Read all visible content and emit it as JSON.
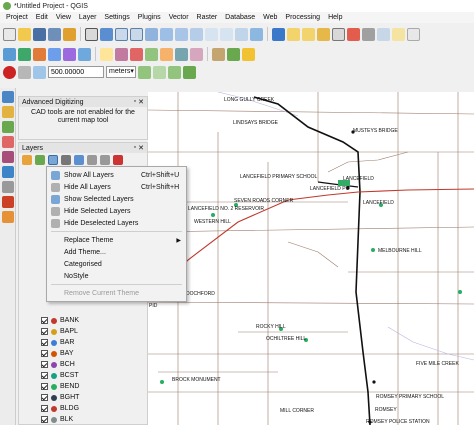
{
  "window": {
    "title": "*Untitled Project - QGIS"
  },
  "menubar": [
    "Project",
    "Edit",
    "View",
    "Layer",
    "Settings",
    "Plugins",
    "Vector",
    "Raster",
    "Database",
    "Web",
    "Processing",
    "Help"
  ],
  "scale": {
    "value": "500.00000",
    "units": "meters"
  },
  "advanced_digitizing": {
    "title": "Advanced Digitizing",
    "message": "CAD tools are not enabled for the current map tool"
  },
  "layers_panel": {
    "title": "Layers",
    "layers": [
      {
        "name": "BANK",
        "color": "#c0392b"
      },
      {
        "name": "BAPL",
        "color": "#d4a017"
      },
      {
        "name": "BAR",
        "color": "#3b7dd8"
      },
      {
        "name": "BAY",
        "color": "#d35400"
      },
      {
        "name": "BCH",
        "color": "#8e44ad"
      },
      {
        "name": "BCST",
        "color": "#16a085"
      },
      {
        "name": "BEND",
        "color": "#27ae60"
      },
      {
        "name": "BGHT",
        "color": "#2c3e50"
      },
      {
        "name": "BLDG",
        "color": "#c0392b"
      },
      {
        "name": "BLK",
        "color": "#7f8c8d"
      }
    ]
  },
  "context_menu": {
    "items": [
      {
        "label": "Show All Layers",
        "shortcut": "Ctrl+Shift+U",
        "icon": "eye-icon"
      },
      {
        "label": "Hide All Layers",
        "shortcut": "Ctrl+Shift+H",
        "icon": "eye-closed-icon"
      },
      {
        "label": "Show Selected Layers",
        "shortcut": "",
        "icon": "eye-icon"
      },
      {
        "label": "Hide Selected Layers",
        "shortcut": "",
        "icon": "eye-closed-icon"
      },
      {
        "label": "Hide Deselected Layers",
        "shortcut": "",
        "icon": "eye-closed-icon"
      }
    ],
    "theme_items": [
      {
        "label": "Replace Theme",
        "submenu": true
      },
      {
        "label": "Add Theme...",
        "submenu": false
      },
      {
        "label": "Categorised",
        "submenu": false
      },
      {
        "label": "NoStyle",
        "submenu": false
      }
    ],
    "remove_theme": "Remove Current Theme"
  },
  "map": {
    "labels": {
      "long_gully_creek": "LONG GULLY CREEK",
      "lindsays_bridge": "LINDSAYS BRIDGE",
      "musteys_bridge": "MUSTEYS BRIDGE",
      "lancefield_ps": "LANCEFIELD PRIMARY SCHOOL",
      "lancefield_town": "LANCEFIELD",
      "lancefield_town2": "LANCEFIELD",
      "lancefield_pp": "LANCEFIELD PO",
      "seven_roads": "SEVEN ROADS CORNER",
      "western_hill": "WESTERN HILL",
      "lancefield_no2": "LANCEFIELD NO. 2 RESERVOIR",
      "melbourne_hill": "MELBOURNE HILL",
      "dochford": "DOCHFORD",
      "rocky_hill": "ROCKY HILL",
      "ochiltree_hill": "OCHILTREE HILL",
      "five_mile_creek": "FIVE MILE CREEK",
      "brock_monument": "BROCK MONUMENT",
      "romsey_ps": "ROMSEY PRIMARY SCHOOL",
      "mill_corner": "MILL CORNER",
      "romsey": "ROMSEY",
      "romsey_police": "ROMSEY POLICE STATION",
      "pid": "PID"
    }
  }
}
